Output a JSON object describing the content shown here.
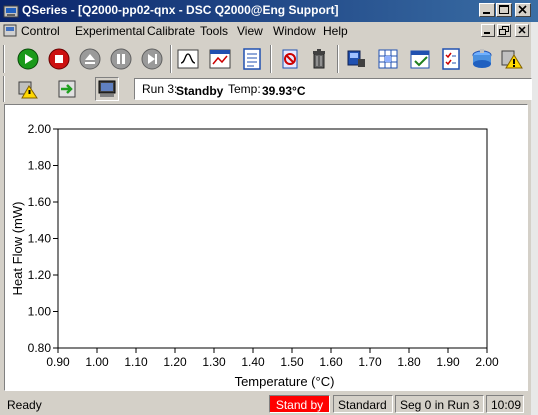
{
  "window": {
    "title": "QSeries - [Q2000-pp02-qnx - DSC Q2000@Eng Support]"
  },
  "menu": {
    "items": [
      {
        "label": "Control"
      },
      {
        "label": "Experimental"
      },
      {
        "label": "Calibrate"
      },
      {
        "label": "Tools"
      },
      {
        "label": "View"
      },
      {
        "label": "Window"
      },
      {
        "label": "Help"
      }
    ]
  },
  "toolbar": {
    "buttons": [
      {
        "name": "start-icon",
        "color": "#1a9a1a"
      },
      {
        "name": "stop-icon",
        "color": "#cc1111"
      },
      {
        "name": "eject-icon",
        "color": "#8a8a8a"
      },
      {
        "name": "pause-icon",
        "color": "#8a8a8a"
      },
      {
        "name": "skip-icon",
        "color": "#8a8a8a"
      },
      {
        "name": "thermogram-icon"
      },
      {
        "name": "plot-icon"
      },
      {
        "name": "notes-icon"
      },
      {
        "name": "flag-icon"
      },
      {
        "name": "trash-icon"
      },
      {
        "name": "instrument-icon"
      },
      {
        "name": "grid-icon"
      },
      {
        "name": "calendar-icon"
      },
      {
        "name": "checklist-icon"
      },
      {
        "name": "autosampler-icon"
      },
      {
        "name": "warning-icon"
      }
    ]
  },
  "status": {
    "run_label": "Run 3:",
    "state": "Standby",
    "temp_label": "Temp:",
    "temp_value": "39.93°C"
  },
  "chart_data": {
    "type": "line",
    "xlabel": "Temperature (°C)",
    "ylabel": "Heat Flow (mW)",
    "xlim": [
      0.9,
      2.0
    ],
    "ylim": [
      0.8,
      2.0
    ],
    "x_ticks": [
      "0.90",
      "1.00",
      "1.10",
      "1.20",
      "1.30",
      "1.40",
      "1.50",
      "1.60",
      "1.70",
      "1.80",
      "1.90",
      "2.00"
    ],
    "y_ticks": [
      "2.00",
      "1.80",
      "1.60",
      "1.40",
      "1.20",
      "1.00",
      "0.80"
    ],
    "series": [],
    "grid": false
  },
  "statusbar": {
    "ready": "Ready",
    "state": "Stand by",
    "state_color": "#ff0000",
    "mode": "Standard",
    "segment": "Seg  0 in Run  3",
    "time": "10:09"
  }
}
